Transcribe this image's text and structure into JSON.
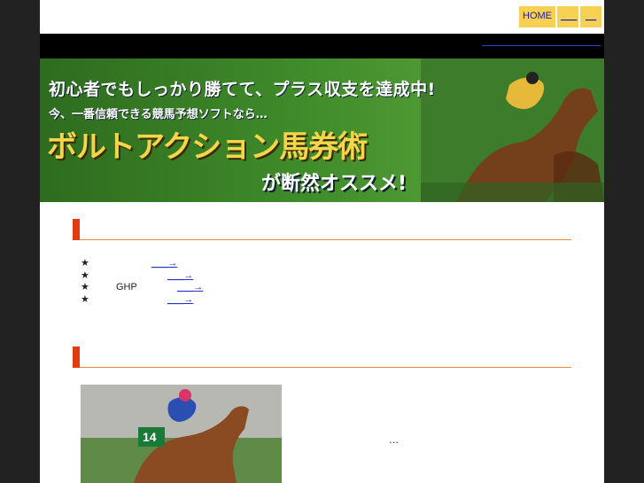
{
  "nav": {
    "home": "HOME",
    "link2": "___",
    "link3": "__"
  },
  "banner": {
    "line1": "初心者でもしっかり勝てて、プラス収支を達成中!",
    "line2": "今、一番信頼できる競馬予想ソフトなら…",
    "line3": "ボルトアクション馬券術",
    "line4": "が断然オススメ!"
  },
  "list": [
    {
      "star": "★",
      "text": "",
      "more": "___→"
    },
    {
      "star": "★",
      "text": "",
      "more": "___→"
    },
    {
      "star": "★",
      "text": "GHP",
      "more": "___→"
    },
    {
      "star": "★",
      "text": "",
      "more": "___→"
    }
  ],
  "photo": {
    "saddle_number": "14"
  },
  "ellipsis": "…",
  "colors": {
    "nav_bg": "#f7d154",
    "accent_bar": "#e23a12",
    "divider": "#e88a3a",
    "banner_green": "#3f8a2a",
    "title_gold": "#f3d64a"
  }
}
